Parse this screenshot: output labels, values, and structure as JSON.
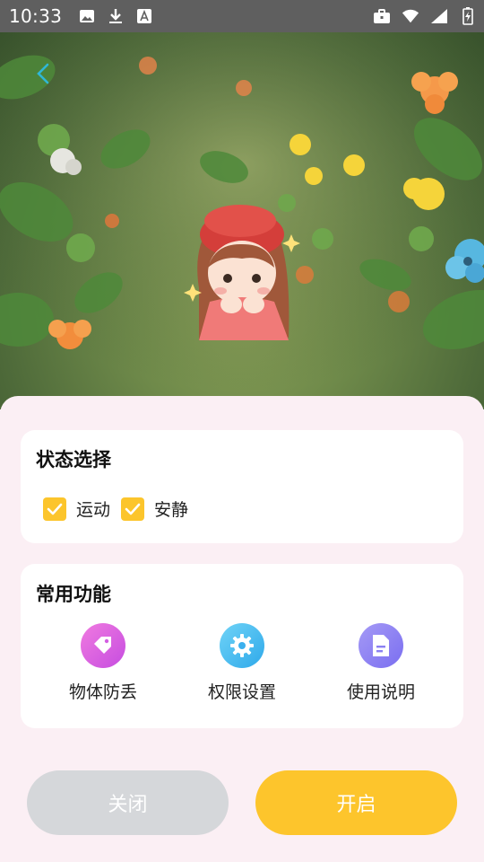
{
  "status_bar": {
    "time": "10:33",
    "left_icons": [
      "image-icon",
      "download-icon",
      "font-icon"
    ],
    "right_icons": [
      "briefcase-icon",
      "wifi-icon",
      "signal-icon",
      "battery-icon"
    ]
  },
  "header": {
    "back_icon": "chevron-left-icon"
  },
  "status_card": {
    "title": "状态选择",
    "options": [
      {
        "label": "运动",
        "checked": true
      },
      {
        "label": "安静",
        "checked": true
      }
    ]
  },
  "functions_card": {
    "title": "常用功能",
    "items": [
      {
        "label": "物体防丢",
        "icon": "tag-icon"
      },
      {
        "label": "权限设置",
        "icon": "gear-icon"
      },
      {
        "label": "使用说明",
        "icon": "document-icon"
      }
    ]
  },
  "actions": {
    "close_label": "关闭",
    "open_label": "开启"
  },
  "colors": {
    "accent": "#fdc52c",
    "sheet_bg": "#fbeff4",
    "disabled": "#d5d7da"
  }
}
